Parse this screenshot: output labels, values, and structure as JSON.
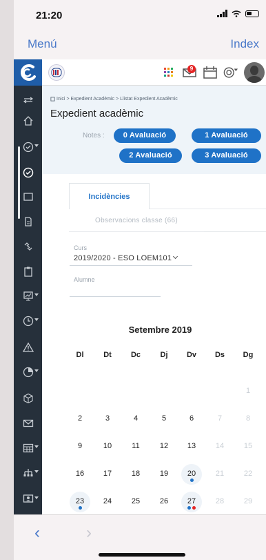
{
  "status_bar": {
    "time": "21:20"
  },
  "nav": {
    "left": "Menú",
    "right": "Index"
  },
  "header": {
    "notification_count": "9"
  },
  "breadcrumb": {
    "items": [
      "Inici",
      "Expedient Acadèmic",
      "Llistat Expedient Acadèmic"
    ]
  },
  "page": {
    "title": "Expedient acadèmic"
  },
  "notes": {
    "label": "Notes :",
    "buttons": [
      "0 Avaluació",
      "1 Avaluació",
      "2 Avaluació",
      "3 Avaluació"
    ]
  },
  "tabs": {
    "active": "Incidències",
    "secondary": "Observacions classe (66)"
  },
  "form": {
    "curs_label": "Curs",
    "curs_value": "2019/2020 - ESO LOEM101",
    "alumne_label": "Alumne"
  },
  "calendar": {
    "title": "Setembre 2019",
    "day_headers": [
      "Dl",
      "Dt",
      "Dc",
      "Dj",
      "Dv",
      "Ds",
      "Dg"
    ],
    "weeks": [
      [
        "",
        "",
        "",
        "",
        "",
        "",
        "1"
      ],
      [
        "2",
        "3",
        "4",
        "5",
        "6",
        "7",
        "8"
      ],
      [
        "9",
        "10",
        "11",
        "12",
        "13",
        "14",
        "15"
      ],
      [
        "16",
        "17",
        "18",
        "19",
        "20",
        "21",
        "22"
      ],
      [
        "23",
        "24",
        "25",
        "26",
        "27",
        "28",
        "29"
      ]
    ],
    "event_days": {
      "20": [
        "#1f72c7"
      ],
      "23": [
        "#1f72c7"
      ],
      "27": [
        "#1f72c7",
        "#e52525"
      ]
    }
  },
  "colors": {
    "accent": "#1f72c7",
    "sidebar": "#26303b",
    "nav_link": "#4a79c9",
    "alert": "#e52525"
  }
}
